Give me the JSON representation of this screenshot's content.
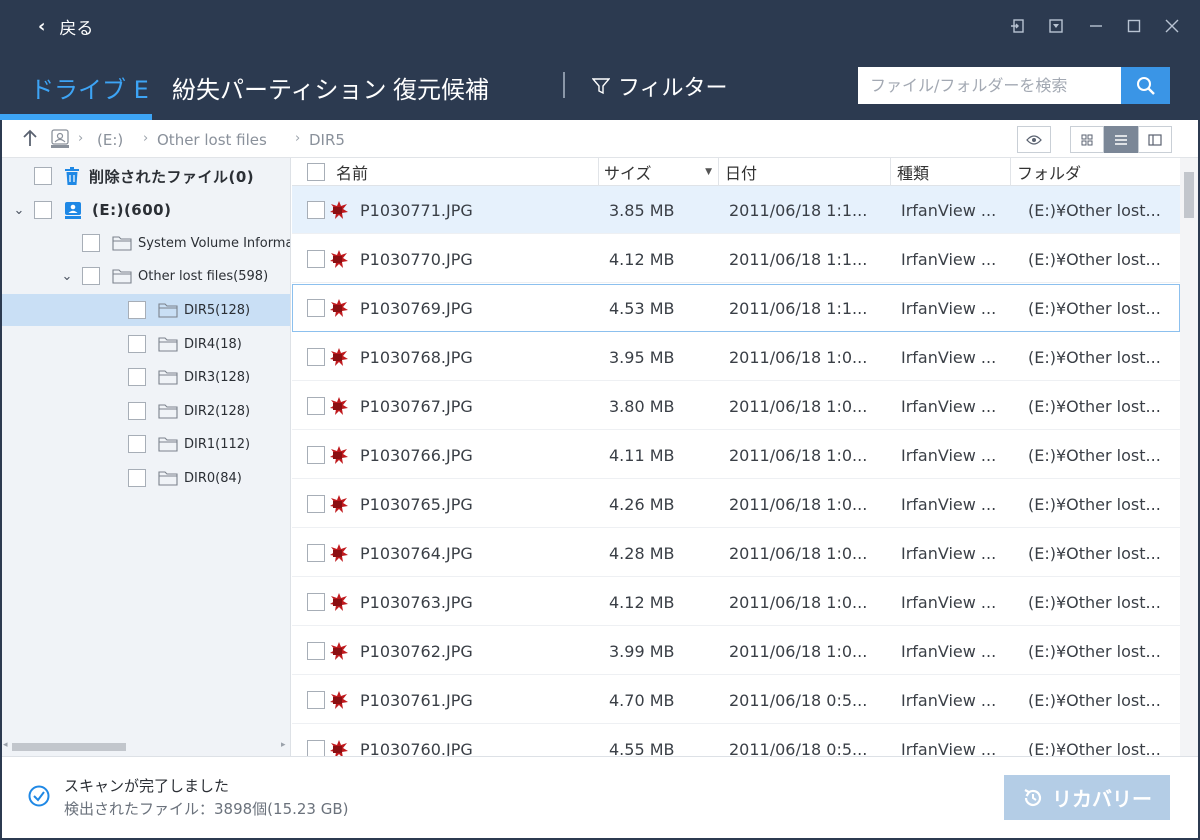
{
  "titlebar": {
    "back_label": "戻る"
  },
  "nav": {
    "tabs": [
      "ドライブ E",
      "紛失パーティション",
      "復元候補"
    ],
    "active_tab": 0,
    "filter_label": "フィルター",
    "search_placeholder": "ファイル/フォルダーを検索"
  },
  "breadcrumb": {
    "items": [
      "(E:)",
      "Other lost files",
      "DIR5"
    ]
  },
  "tree": {
    "deleted": "削除されたファイル(0)",
    "drive": "(E:)(600)",
    "system_volume": "System Volume Informat",
    "other_lost": "Other lost files(598)",
    "dirs": [
      "DIR5(128)",
      "DIR4(18)",
      "DIR3(128)",
      "DIR2(128)",
      "DIR1(112)",
      "DIR0(84)"
    ],
    "selected_dir": 0
  },
  "table": {
    "headers": {
      "name": "名前",
      "size": "サイズ",
      "date": "日付",
      "type": "種類",
      "folder": "フォルダ"
    },
    "rows": [
      {
        "name": "P1030771.JPG",
        "size": "3.85 MB",
        "date": "2011/06/18 1:1...",
        "type": "IrfanView ...",
        "folder": "(E:)¥Other lost..."
      },
      {
        "name": "P1030770.JPG",
        "size": "4.12 MB",
        "date": "2011/06/18 1:1...",
        "type": "IrfanView ...",
        "folder": "(E:)¥Other lost..."
      },
      {
        "name": "P1030769.JPG",
        "size": "4.53 MB",
        "date": "2011/06/18 1:1...",
        "type": "IrfanView ...",
        "folder": "(E:)¥Other lost..."
      },
      {
        "name": "P1030768.JPG",
        "size": "3.95 MB",
        "date": "2011/06/18 1:0...",
        "type": "IrfanView ...",
        "folder": "(E:)¥Other lost..."
      },
      {
        "name": "P1030767.JPG",
        "size": "3.80 MB",
        "date": "2011/06/18 1:0...",
        "type": "IrfanView ...",
        "folder": "(E:)¥Other lost..."
      },
      {
        "name": "P1030766.JPG",
        "size": "4.11 MB",
        "date": "2011/06/18 1:0...",
        "type": "IrfanView ...",
        "folder": "(E:)¥Other lost..."
      },
      {
        "name": "P1030765.JPG",
        "size": "4.26 MB",
        "date": "2011/06/18 1:0...",
        "type": "IrfanView ...",
        "folder": "(E:)¥Other lost..."
      },
      {
        "name": "P1030764.JPG",
        "size": "4.28 MB",
        "date": "2011/06/18 1:0...",
        "type": "IrfanView ...",
        "folder": "(E:)¥Other lost..."
      },
      {
        "name": "P1030763.JPG",
        "size": "4.12 MB",
        "date": "2011/06/18 1:0...",
        "type": "IrfanView ...",
        "folder": "(E:)¥Other lost..."
      },
      {
        "name": "P1030762.JPG",
        "size": "3.99 MB",
        "date": "2011/06/18 1:0...",
        "type": "IrfanView ...",
        "folder": "(E:)¥Other lost..."
      },
      {
        "name": "P1030761.JPG",
        "size": "4.70 MB",
        "date": "2011/06/18 0:5...",
        "type": "IrfanView ...",
        "folder": "(E:)¥Other lost..."
      },
      {
        "name": "P1030760.JPG",
        "size": "4.55 MB",
        "date": "2011/06/18 0:5...",
        "type": "IrfanView ...",
        "folder": "(E:)¥Other lost..."
      }
    ]
  },
  "status": {
    "title": "スキャンが完了しました",
    "detail": "検出されたファイル：3898個(15.23 GB)",
    "recover_label": "リカバリー"
  },
  "colors": {
    "chrome": "#2c3a50",
    "accent": "#3da4f5",
    "selected_row": "#e6f1fc",
    "tree_selected": "#c9dff5",
    "recover_disabled": "#b4cde6"
  },
  "icons": {
    "back": "chevron-left-icon",
    "search": "search-icon",
    "filter": "filter-funnel-icon",
    "up": "arrow-up-icon",
    "drive": "drive-icon",
    "trash": "trash-icon",
    "folder": "folder-icon",
    "file": "jpg-file-icon",
    "preview": "eye-icon",
    "grid_view": "grid-view-icon",
    "list_view": "list-view-icon",
    "detail_view": "detail-view-icon",
    "status_ok": "check-circle-icon",
    "recover": "restore-icon"
  }
}
